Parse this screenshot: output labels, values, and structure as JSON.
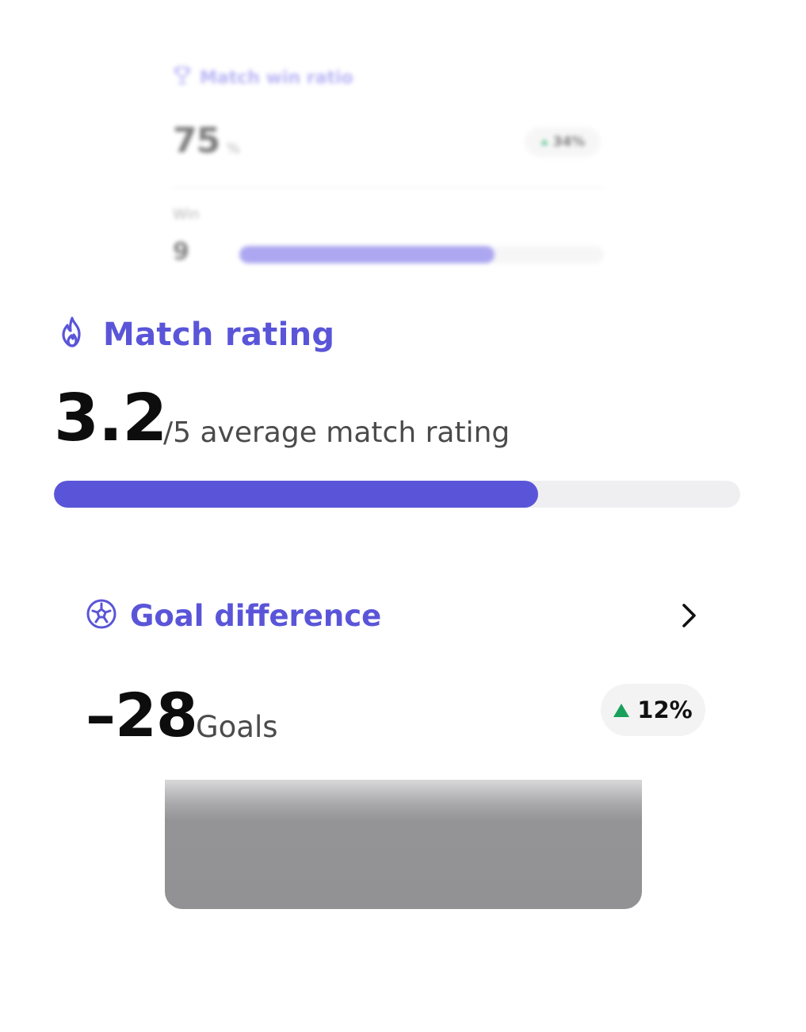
{
  "win_ratio_card": {
    "title": "Match win ratio",
    "value": "75",
    "unit": "%",
    "change": "34%",
    "change_direction": "up",
    "win_label": "Win",
    "win_count": "9",
    "win_progress_fraction": 0.7,
    "icon": "trophy-icon"
  },
  "match_rating": {
    "title": "Match rating",
    "icon": "flame-icon",
    "value": "3.2",
    "suffix": "/5 average match rating",
    "progress_fraction": 0.706
  },
  "goal_difference": {
    "title": "Goal difference",
    "icon": "soccer-ball-icon",
    "value": "–28",
    "unit": "Goals",
    "change": "12%",
    "change_direction": "up",
    "chevron_icon": "chevron-right-icon"
  },
  "colors": {
    "accent": "#5a55d8",
    "positive": "#19a05a",
    "track": "#efeff1"
  }
}
